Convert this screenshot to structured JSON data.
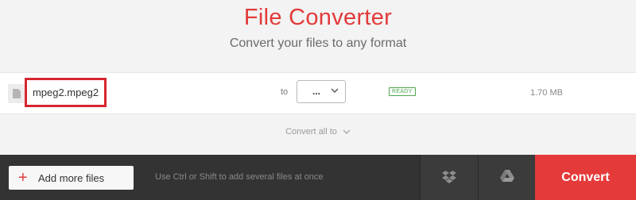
{
  "header": {
    "title": "File Converter",
    "subtitle": "Convert your files to any format"
  },
  "file": {
    "name": "mpeg2.mpeg2",
    "to_label": "to",
    "format_value": "...",
    "status": "READY",
    "size": "1.70 MB"
  },
  "convert_all": {
    "label": "Convert all to"
  },
  "footer": {
    "add_files_label": "Add more files",
    "hint": "Use Ctrl or Shift to add several files at once",
    "convert_label": "Convert"
  },
  "icons": {
    "file": "file-icon",
    "chevron": "chevron-down-icon",
    "plus": "plus-icon",
    "dropbox": "dropbox-icon",
    "google_drive": "google-drive-icon"
  },
  "colors": {
    "accent": "#e23a3a",
    "ready": "#4ca74c",
    "highlight": "#d6262f",
    "bar": "#333333"
  }
}
